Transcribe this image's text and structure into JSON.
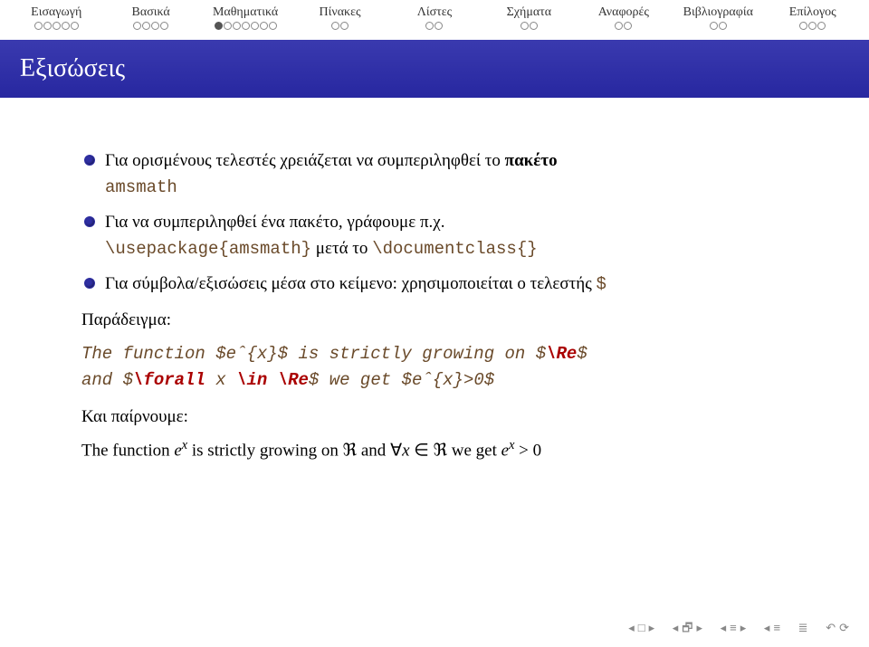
{
  "nav": [
    {
      "label": "Εισαγωγή",
      "dots": 5,
      "filled": -1
    },
    {
      "label": "Βασικά",
      "dots": 4,
      "filled": -1
    },
    {
      "label": "Μαθηματικά",
      "dots": 7,
      "filled": 0
    },
    {
      "label": "Πίνακες",
      "dots": 2,
      "filled": -1
    },
    {
      "label": "Λίστες",
      "dots": 2,
      "filled": -1
    },
    {
      "label": "Σχήματα",
      "dots": 2,
      "filled": -1
    },
    {
      "label": "Αναφορές",
      "dots": 2,
      "filled": -1
    },
    {
      "label": "Βιβλιογραφία",
      "dots": 2,
      "filled": -1
    },
    {
      "label": "Επίλογος",
      "dots": 3,
      "filled": -1
    }
  ],
  "title": "Εξισώσεις",
  "bullet1_a": "Για ορισμένους τελεστές χρειάζεται να συμπεριληφθεί το ",
  "bullet1_bold": "πακέτο",
  "bullet1_tt": "amsmath",
  "bullet2_a": "Για να συμπεριληφθεί ένα πακέτο, γράφουμε π.χ.",
  "bullet2_code1": "\\usepackage{amsmath}",
  "bullet2_mid": " μετά το ",
  "bullet2_code2": "\\documentclass{}",
  "bullet3_a": "Για σύμβολα/εξισώσεις μέσα στο κείμενο: χρησιμοποιείται ο τελεστής ",
  "bullet3_code": "$",
  "example_label": "Παράδειγμα:",
  "code_line1_pieces": {
    "p1": "The function ",
    "d1": "$",
    "p2": "eˆ{x}",
    "d2": "$",
    "p3": " is strictly growing on ",
    "d3": "$",
    "kw1": "\\Re",
    "d4": "$"
  },
  "code_line2_pieces": {
    "p1": "and ",
    "d1": "$",
    "kw1": "\\forall",
    "p2": " x ",
    "kw2": "\\in",
    "p3": " ",
    "kw3": "\\Re",
    "d2": "$",
    "p4": " we get ",
    "d3": "$",
    "p5": "eˆ{x}>0",
    "d4": "$"
  },
  "result_label": "Και παίρνουμε:",
  "result_line": {
    "p1": "The function ",
    "e1": "e",
    "x1": "x",
    "p2": " is strictly growing on ",
    "re1": "ℜ",
    "p3": " and ",
    "forall": "∀",
    "xvar": "x",
    "in": " ∈ ",
    "re2": "ℜ",
    "p4": " we get ",
    "e2": "e",
    "x2": "x",
    "gt": " > ",
    "zero": "0"
  }
}
